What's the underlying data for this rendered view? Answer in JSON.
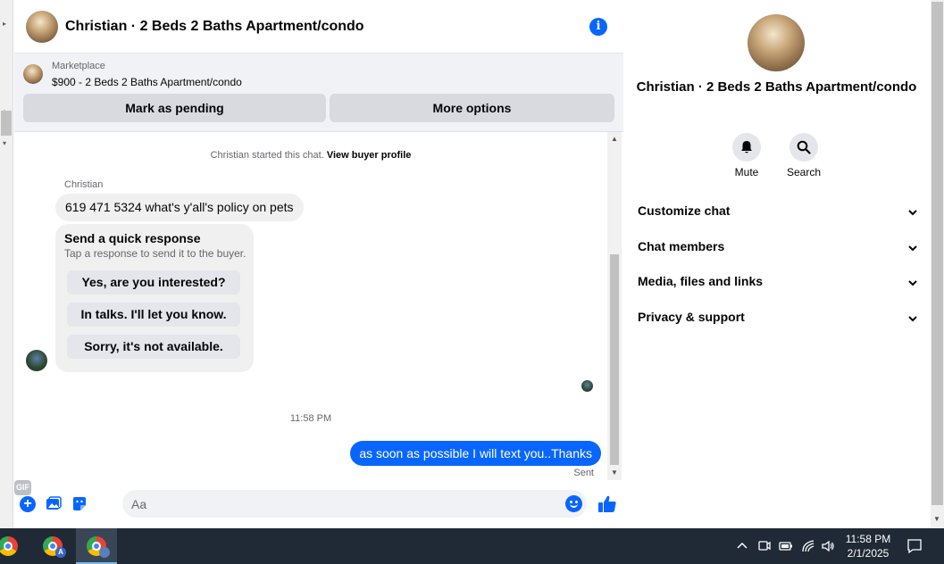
{
  "chat_header": {
    "title": "Christian · 2 Beds 2 Baths Apartment/condo",
    "info_icon": "info-icon"
  },
  "marketplace": {
    "label": "Marketplace",
    "listing": "$900 - 2 Beds 2 Baths Apartment/condo",
    "pending_button": "Mark as pending",
    "more_button": "More options"
  },
  "messages": {
    "system_text": "Christian started this chat.",
    "system_link": "View buyer profile",
    "sender_name": "Christian",
    "incoming_text": "619 471 5324 what's y'all's policy on pets",
    "quick_title": "Send a quick response",
    "quick_subtitle": "Tap a response to send it to the buyer.",
    "quick_responses": [
      "Yes, are you interested?",
      "In talks. I'll let you know.",
      "Sorry, it's not available."
    ],
    "timestamp": "11:58 PM",
    "outgoing_text": "as soon as possible I will text you..Thanks",
    "sent_label": "Sent"
  },
  "composer": {
    "placeholder": "Aa",
    "gif_label": "GIF"
  },
  "info_panel": {
    "title": "Christian · 2 Beds 2 Baths Apartment/condo",
    "mute_label": "Mute",
    "search_label": "Search",
    "sections": [
      "Customize chat",
      "Chat members",
      "Media, files and links",
      "Privacy & support"
    ]
  },
  "taskbar": {
    "time": "11:58 PM",
    "date": "2/1/2025",
    "badge": "A"
  },
  "colors": {
    "accent": "#0866ff",
    "bubble_incoming": "#f0f0f0",
    "bar_bg": "#f0f2f5",
    "taskbar": "#1f2a36"
  }
}
